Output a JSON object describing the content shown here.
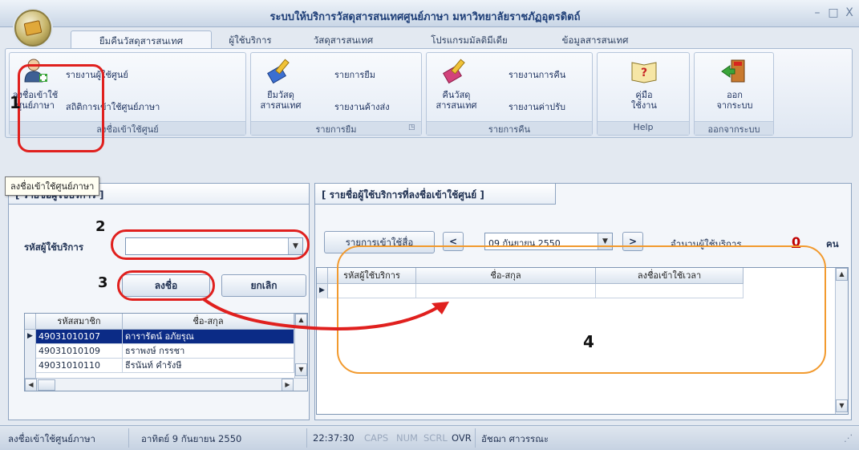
{
  "window": {
    "title": "ระบบให้บริการวัสดุสารสนเทศศูนย์ภาษา มหาวิทยาลัยราชภัฏอุตรดิตถ์",
    "controls": [
      "–",
      "□",
      "X"
    ]
  },
  "tabs": [
    "ยืมคืนวัสดุสารสนเทศ",
    "ผู้ใช้บริการ",
    "วัสดุสารสนเทศ",
    "โปรแกรมมัลติมีเดีย",
    "ข้อมูลสารสนเทศ"
  ],
  "ribbon": {
    "register_group": {
      "big_label_1": "ลงชื่อเข้าใช้",
      "big_label_2": "ศูนย์ภาษา",
      "item1": "รายงานผู้ใช้ศูนย์",
      "item2": "สถิติการเข้าใช้ศูนย์ภาษา",
      "label": "ลงชื่อเข้าใช้ศูนย์"
    },
    "borrow_group": {
      "big_label_1": "ยืมวัสดุ",
      "big_label_2": "สารสนเทศ",
      "item1": "รายการยืม",
      "item2": "รายงานค้างส่ง",
      "label": "รายการยืม"
    },
    "return_group": {
      "big_label_1": "คืนวัสดุ",
      "big_label_2": "สารสนเทศ",
      "item1": "รายงานการคืน",
      "item2": "รายงานค่าปรับ",
      "label": "รายการคืน"
    },
    "help_group": {
      "big_label_1": "คู่มือ",
      "big_label_2": "ใช้งาน",
      "label": "Help"
    },
    "exit_group": {
      "big_label_1": "ออก",
      "big_label_2": "จากระบบ",
      "label": "ออกจากระบบ"
    }
  },
  "annotations": {
    "n1": "1",
    "n2": "2",
    "n3": "3",
    "n4": "4"
  },
  "tooltip": "ลงชื่อเข้าใช้ศูนย์ภาษา",
  "left_panel": {
    "header": "[ รายชื่อผู้ใช้บริการ ]",
    "field_label": "รหัสผู้ใช้บริการ",
    "field_value": "",
    "save_button": "ลงชื่อ",
    "cancel_button": "ยกเลิก",
    "columns": [
      "รหัสสมาชิก",
      "ชื่อ-สกุล"
    ],
    "rows": [
      {
        "id": "49031010107",
        "name": "ดารารัตน์ อภัยรุณ"
      },
      {
        "id": "49031010109",
        "name": "ธราพงษ์ กรรชา"
      },
      {
        "id": "49031010110",
        "name": "ธีรนันท์ คำรังษี"
      }
    ]
  },
  "right_panel": {
    "header": "[ รายชื่อผู้ใช้บริการที่ลงชื่อเข้าใช้ศูนย์ ]",
    "list_button": "รายการเข้าใช้สื่อ",
    "prev": "<",
    "next": ">",
    "date": "09 กันยายน 2550",
    "count_label": "จำนวนผู้ใช้บริการ",
    "count": "0",
    "unit": "คน",
    "columns": [
      "รหัสผู้ใช้บริการ",
      "ชื่อ-สกุล",
      "ลงชื่อเข้าใช้เวลา"
    ]
  },
  "status": {
    "task": "ลงชื่อเข้าใช้ศูนย์ภาษา",
    "date": "อาทิตย์ 9 กันยายน 2550",
    "time": "22:37:30",
    "caps": "CAPS",
    "num": "NUM",
    "scrl": "SCRL",
    "ovr": "OVR",
    "user": "อัชฌา ศาวรรณะ"
  },
  "colors": {
    "annotation_red": "#e0201e",
    "annotation_orange": "#f29a2e",
    "selection": "#0b2b86",
    "count_red": "#c00000"
  }
}
